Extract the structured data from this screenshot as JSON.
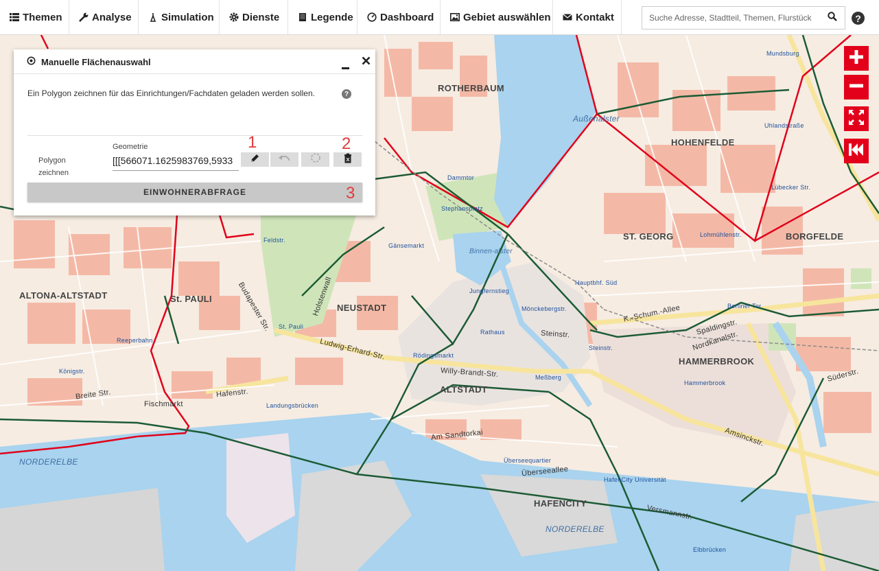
{
  "nav": {
    "items": [
      {
        "label": "Themen",
        "icon": "list-icon"
      },
      {
        "label": "Analyse",
        "icon": "wrench-icon"
      },
      {
        "label": "Simulation",
        "icon": "flask-icon"
      },
      {
        "label": "Dienste",
        "icon": "gear-icon"
      },
      {
        "label": "Legende",
        "icon": "book-icon"
      },
      {
        "label": "Dashboard",
        "icon": "dashboard-icon"
      },
      {
        "label": "Gebiet auswählen",
        "icon": "picture-icon"
      },
      {
        "label": "Kontakt",
        "icon": "envelope-icon"
      }
    ],
    "search_placeholder": "Suche Adresse, Stadtteil, Themen, Flurstück",
    "help_label": "?"
  },
  "panel": {
    "title": "Manuelle Flächenauswahl",
    "description": "Ein Polygon zeichnen für das Einrichtungen/Fachdaten geladen werden sollen.",
    "help_label": "?",
    "polygon_label": "Polygon zeichnen",
    "geometry_label": "Geometrie",
    "geometry_value": "[[[566071.1625983769,5933",
    "query_button": "EINWOHNERABFRAGE",
    "annotations": [
      "1",
      "2",
      "3"
    ]
  },
  "map": {
    "districts": [
      "ROTHERBAUM",
      "HOHENFELDE",
      "ST. GEORG",
      "BORGFELDE",
      "ALTONA-ALTSTADT",
      "St. PAULI",
      "NEUSTADT",
      "ALTSTADT",
      "HAMMERBROOK",
      "HAFENCITY"
    ],
    "water": [
      "Außenalster",
      "Binnen-alster",
      "NORDERELBE",
      "NORDERELBE"
    ],
    "stations": [
      "Dammtor",
      "Stephansplatz",
      "Gänsemarkt",
      "Feldstr.",
      "Reeperbahn",
      "Königstr.",
      "Landungsbrücken",
      "Rödingsmarkt",
      "Jungfernstieg",
      "Rathaus",
      "Mönckebergstr.",
      "Steinstr.",
      "Hauptbhf. Süd",
      "Berliner Tor",
      "Hammerbrook",
      "Lübecker Str.",
      "Uhlandstraße",
      "Mundsburg",
      "Lohmühlenstr.",
      "HafenCity Universität",
      "Überseequartier",
      "Elbbrücken",
      "St. Pauli",
      "Meßberg"
    ],
    "streets": [
      "Ludwig-Erhard-Str.",
      "Willy-Brandt-Str.",
      "Am Sandtorkai",
      "Versmannstr.",
      "Amsinckstr.",
      "K.-Schum.-Allee",
      "Nordkanalstr.",
      "Spaldingstr.",
      "Süderstr.",
      "Breite Str.",
      "Hafenstr.",
      "Budapester Str.",
      "Holstenwall",
      "Steinstr.",
      "Überseeallee",
      "Fischmarkt"
    ]
  },
  "controls": [
    "zoom-in",
    "zoom-out",
    "fullscreen",
    "reset-view"
  ]
}
